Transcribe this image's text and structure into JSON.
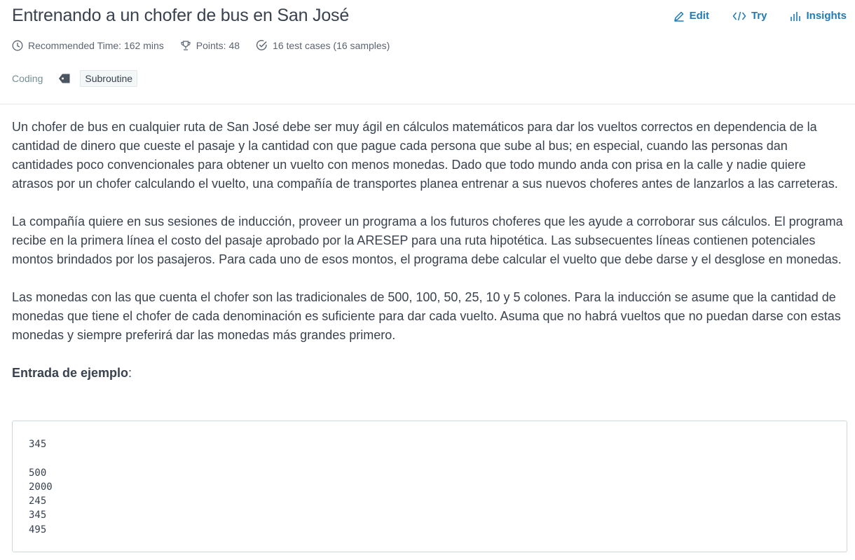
{
  "header": {
    "title": "Entrenando a un chofer de bus en San José",
    "actions": [
      {
        "label": "Edit",
        "icon": "pencil-icon"
      },
      {
        "label": "Try",
        "icon": "code-icon"
      },
      {
        "label": "Insights",
        "icon": "bar-chart-icon"
      }
    ],
    "meta": {
      "recommended_time": "Recommended Time: 162 mins",
      "points": "Points: 48",
      "test_cases": "16 test cases (16 samples)"
    },
    "type_label": "Coding",
    "tag": "Subroutine"
  },
  "body": {
    "paragraphs": [
      "Un chofer de bus en cualquier ruta de San José debe ser muy ágil en cálculos matemáticos para dar los vueltos correctos en dependencia de la cantidad de dinero que cueste el pasaje y la cantidad con que pague cada persona que sube al bus; en especial, cuando las personas dan cantidades poco convencionales para obtener un vuelto con menos monedas. Dado que todo mundo anda con prisa en la calle y nadie quiere atrasos por un chofer calculando el vuelto, una compañía de transportes planea entrenar a sus nuevos choferes antes de lanzarlos a las carreteras.",
      "La compañía quiere en sus sesiones de inducción, proveer un programa a los futuros choferes que les ayude a corroborar sus cálculos. El programa recibe en la primera línea el costo del pasaje aprobado por la ARESEP para una ruta hipotética. Las subsecuentes líneas contienen potenciales montos brindados por los pasajeros. Para cada uno de esos montos, el programa debe calcular el vuelto que debe darse y el desglose en monedas.",
      "Las monedas con las que cuenta el chofer son las tradicionales de 500, 100, 50, 25, 10 y 5 colones. Para la inducción se asume que la cantidad de monedas que tiene el chofer de cada denominación es suficiente para dar cada vuelto. Asuma que no habrá vueltos que no puedan darse con estas monedas y siempre preferirá dar las monedas más grandes primero."
    ],
    "example_label": "Entrada de ejemplo",
    "example_suffix": ":",
    "example_input": "345\n\n500\n2000\n245\n345\n495"
  },
  "colors": {
    "accent": "#1f7ab8",
    "text": "#39424e"
  }
}
